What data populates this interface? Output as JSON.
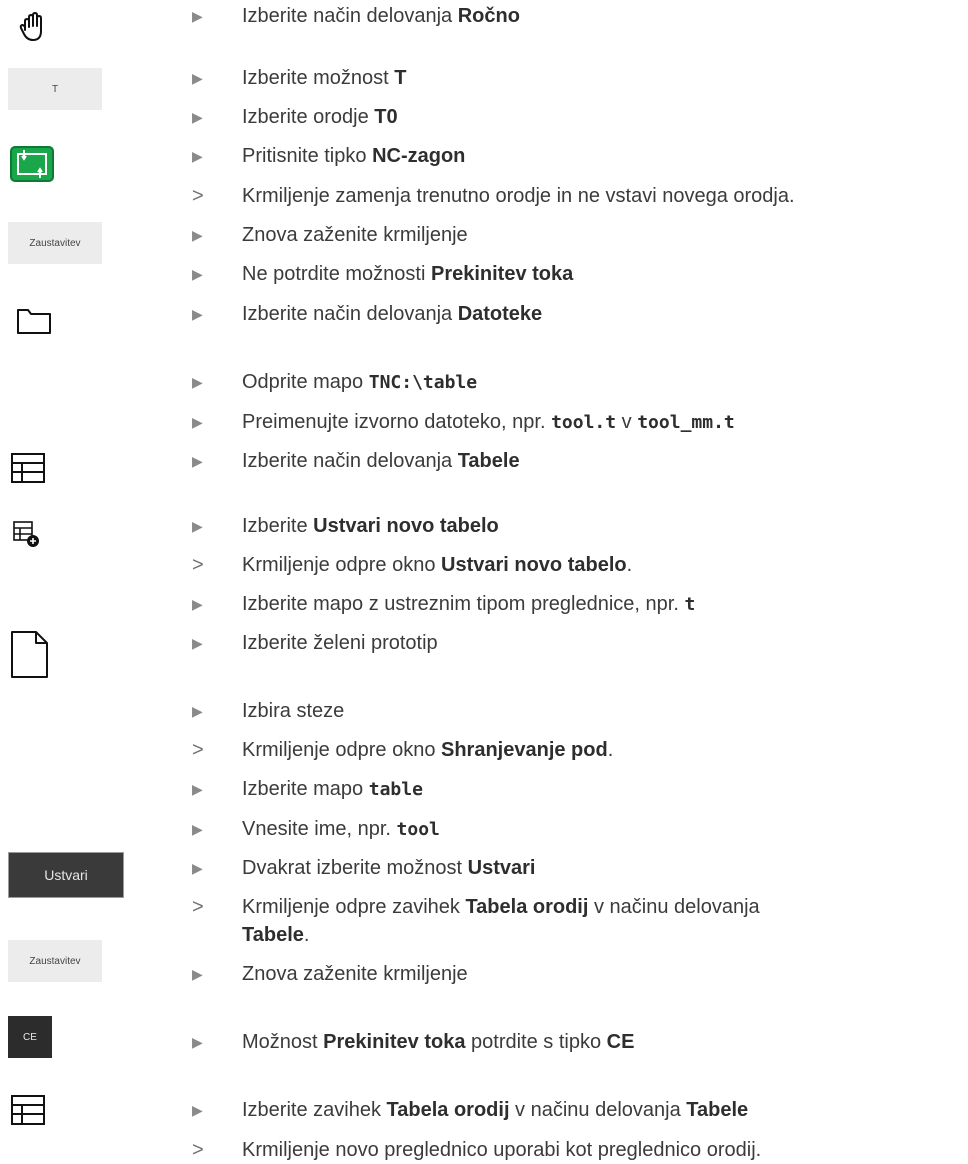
{
  "icons": {
    "hand": "hand-icon",
    "nc_start": "nc-start-icon",
    "folder": "folder-icon",
    "table": "table-icon",
    "table_add": "table-add-icon",
    "file": "file-icon"
  },
  "buttons": {
    "t": "T",
    "zaustavitev_1": "Zaustavitev",
    "ustvari": "Ustvari",
    "zaustavitev_2": "Zaustavitev",
    "ce": "CE"
  },
  "colors": {
    "nc_start_green": "#1aa64a",
    "bullet_gray": "#8a8a8a"
  },
  "steps": [
    {
      "kind": "action",
      "parts": [
        {
          "t": "Izberite način delovanja "
        },
        {
          "b": "Ročno"
        }
      ]
    },
    {
      "kind": "action",
      "parts": [
        {
          "t": "Izberite možnost "
        },
        {
          "b": "T"
        }
      ]
    },
    {
      "kind": "action",
      "parts": [
        {
          "t": "Izberite orodje "
        },
        {
          "b": "T0"
        }
      ]
    },
    {
      "kind": "action",
      "parts": [
        {
          "t": "Pritisnite tipko "
        },
        {
          "b": "NC-zagon"
        }
      ]
    },
    {
      "kind": "result",
      "parts": [
        {
          "t": "Krmiljenje zamenja trenutno orodje in ne vstavi novega orodja."
        }
      ]
    },
    {
      "kind": "action",
      "parts": [
        {
          "t": "Znova zaženite krmiljenje"
        }
      ]
    },
    {
      "kind": "action",
      "parts": [
        {
          "t": "Ne potrdite možnosti "
        },
        {
          "b": "Prekinitev toka"
        }
      ]
    },
    {
      "kind": "action",
      "parts": [
        {
          "t": "Izberite način delovanja "
        },
        {
          "b": "Datoteke"
        }
      ]
    },
    {
      "kind": "action",
      "parts": [
        {
          "t": "Odprite mapo "
        },
        {
          "m": "TNC:\\table"
        }
      ]
    },
    {
      "kind": "action",
      "parts": [
        {
          "t": "Preimenujte izvorno datoteko, npr. "
        },
        {
          "m": "tool.t"
        },
        {
          "t": " v "
        },
        {
          "m": "tool_mm.t"
        }
      ]
    },
    {
      "kind": "action",
      "parts": [
        {
          "t": "Izberite način delovanja "
        },
        {
          "b": "Tabele"
        }
      ]
    },
    {
      "kind": "action",
      "parts": [
        {
          "t": "Izberite "
        },
        {
          "b": "Ustvari novo tabelo"
        }
      ]
    },
    {
      "kind": "result",
      "parts": [
        {
          "t": "Krmiljenje odpre okno "
        },
        {
          "b": "Ustvari novo tabelo"
        },
        {
          "t": "."
        }
      ]
    },
    {
      "kind": "action",
      "parts": [
        {
          "t": "Izberite mapo z ustreznim tipom preglednice, npr. "
        },
        {
          "m": "t"
        }
      ]
    },
    {
      "kind": "action",
      "parts": [
        {
          "t": "Izberite želeni prototip"
        }
      ]
    },
    {
      "kind": "action",
      "parts": [
        {
          "t": "Izbira steze"
        }
      ]
    },
    {
      "kind": "result",
      "parts": [
        {
          "t": "Krmiljenje odpre okno "
        },
        {
          "b": "Shranjevanje pod"
        },
        {
          "t": "."
        }
      ]
    },
    {
      "kind": "action",
      "parts": [
        {
          "t": "Izberite mapo "
        },
        {
          "m": "table"
        }
      ]
    },
    {
      "kind": "action",
      "parts": [
        {
          "t": "Vnesite ime, npr. "
        },
        {
          "m": "tool"
        }
      ]
    },
    {
      "kind": "action",
      "parts": [
        {
          "t": "Dvakrat izberite možnost "
        },
        {
          "b": "Ustvari"
        }
      ]
    },
    {
      "kind": "result",
      "parts": [
        {
          "t": "Krmiljenje odpre zavihek "
        },
        {
          "b": "Tabela orodij"
        },
        {
          "t": " v načinu delovanja "
        },
        {
          "br": true
        },
        {
          "b": "Tabele"
        },
        {
          "t": "."
        }
      ]
    },
    {
      "kind": "action",
      "parts": [
        {
          "t": "Znova zaženite krmiljenje"
        }
      ]
    },
    {
      "kind": "action",
      "parts": [
        {
          "t": "Možnost "
        },
        {
          "b": "Prekinitev toka"
        },
        {
          "t": " potrdite s tipko "
        },
        {
          "b": "CE"
        }
      ]
    },
    {
      "kind": "action",
      "parts": [
        {
          "t": "Izberite zavihek "
        },
        {
          "b": "Tabela orodij"
        },
        {
          "t": " v načinu delovanja "
        },
        {
          "b": "Tabele"
        }
      ]
    },
    {
      "kind": "result",
      "parts": [
        {
          "t": "Krmiljenje novo preglednico uporabi kot preglednico orodij."
        }
      ]
    }
  ]
}
